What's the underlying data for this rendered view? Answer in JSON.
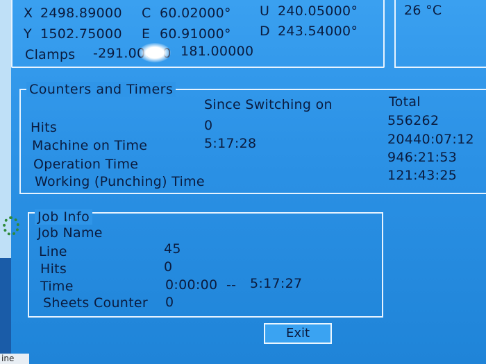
{
  "position": {
    "x_label": "X",
    "x_value": "2498.89000",
    "y_label": "Y",
    "y_value": "1502.75000",
    "c_label": "C",
    "c_value": "60.02000°",
    "e_label": "E",
    "e_value": "60.91000°",
    "u_label": "U",
    "u_value": "240.05000°",
    "d_label": "D",
    "d_value": "243.54000°",
    "clamps_label": "Clamps",
    "clamps_value_1": "-291.00000",
    "clamps_value_2": "181.00000"
  },
  "temperature": {
    "value": "26 °C"
  },
  "counters": {
    "title": "Counters and Timers",
    "col_since": "Since Switching on",
    "col_total": "Total",
    "rows": [
      {
        "label": "Hits",
        "since": "0",
        "total": "556262"
      },
      {
        "label": "Machine on Time",
        "since": "5:17:28",
        "total": "20440:07:12"
      },
      {
        "label": "Operation Time",
        "since": "",
        "total": "946:21:53"
      },
      {
        "label": "Working (Punching) Time",
        "since": "",
        "total": "121:43:25"
      }
    ]
  },
  "job_info": {
    "title": "Job Info",
    "job_name_label": "Job Name",
    "line_label": "Line",
    "line_value": "45",
    "hits_label": "Hits",
    "hits_value": "0",
    "time_label": "Time",
    "time_start": "0:00:00",
    "time_sep": "--",
    "time_end": "5:17:27",
    "sheets_label": "Sheets Counter",
    "sheets_value": "0"
  },
  "buttons": {
    "exit": "Exit"
  },
  "taskbar": {
    "label": "ine"
  }
}
